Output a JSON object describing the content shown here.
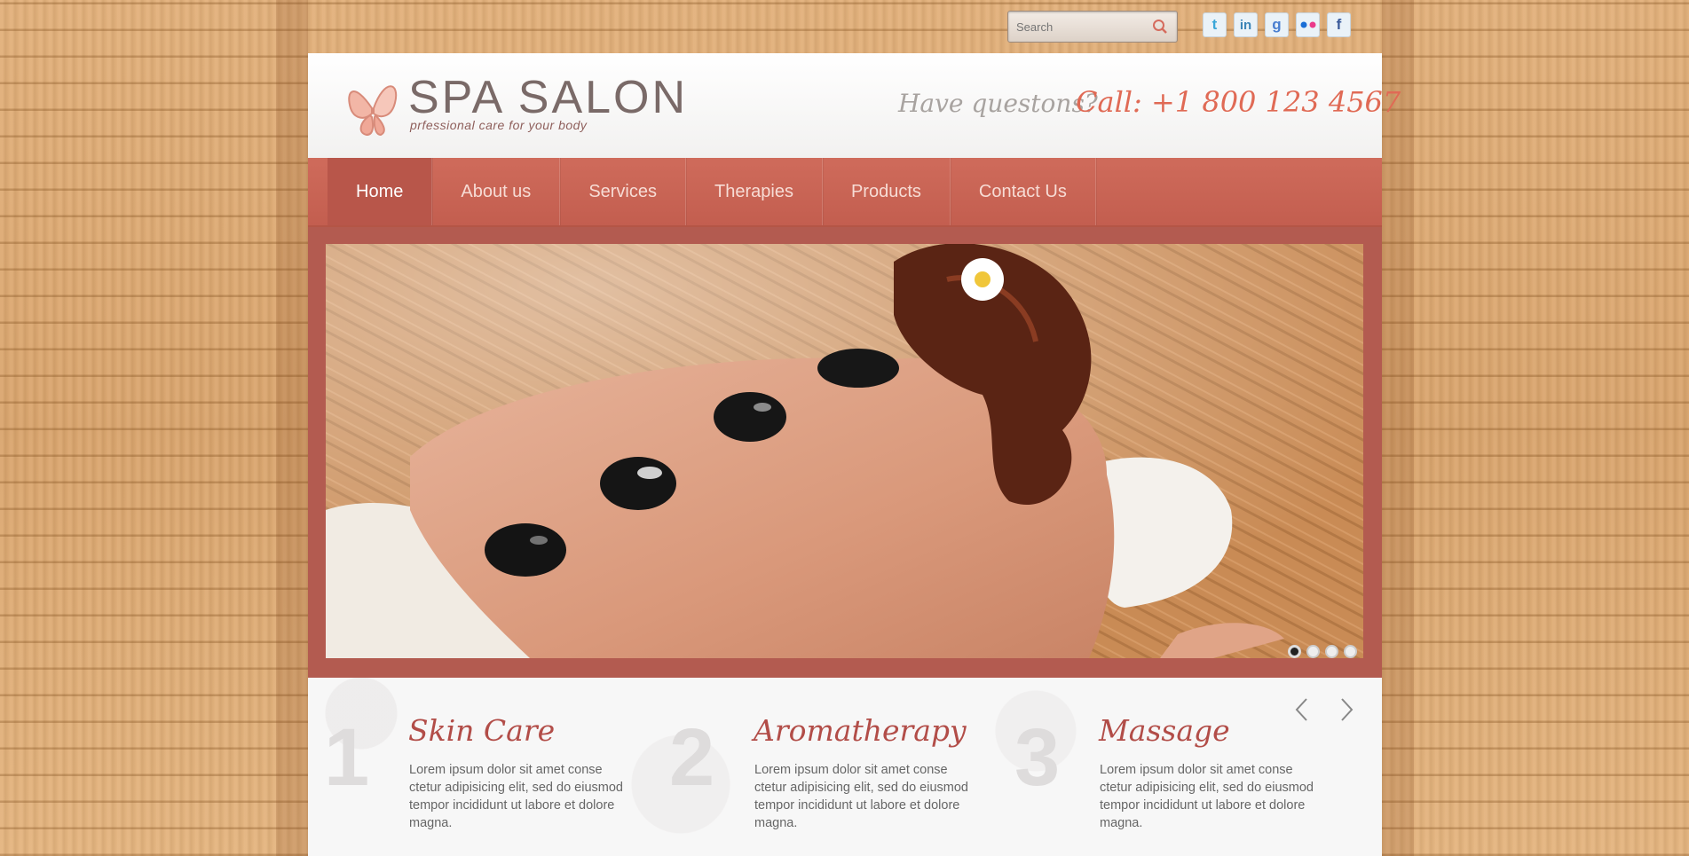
{
  "search": {
    "placeholder": "Search"
  },
  "social": [
    "twitter-icon",
    "linkedin-icon",
    "google-icon",
    "flickr-icon",
    "facebook-icon"
  ],
  "header": {
    "logo_title": "SPA SALON",
    "logo_tagline": "prfessional care  for your body",
    "question": "Have questons?",
    "phone": "Call: +1 800 123 4567"
  },
  "nav": {
    "items": [
      "Home",
      "About us",
      "Services",
      "Therapies",
      "Products",
      "Contact Us"
    ],
    "active": "Home"
  },
  "slider": {
    "slide_count": 4,
    "current_slide": 1
  },
  "services": [
    {
      "number": "1",
      "title": "Skin Care",
      "text": "Lorem ipsum dolor sit amet conse ctetur adipisicing elit, sed do eiusmod tempor incididunt ut labore et dolore magna."
    },
    {
      "number": "2",
      "title": "Aromatherapy",
      "text": "Lorem ipsum dolor sit amet conse ctetur adipisicing elit, sed do eiusmod tempor incididunt ut labore et dolore magna."
    },
    {
      "number": "3",
      "title": "Massage",
      "text": "Lorem ipsum dolor sit amet conse ctetur adipisicing elit, sed do eiusmod tempor incididunt ut labore et dolore magna."
    }
  ],
  "colors": {
    "accent": "#c9685a",
    "title": "#b24d48",
    "phone": "#e06a55"
  }
}
